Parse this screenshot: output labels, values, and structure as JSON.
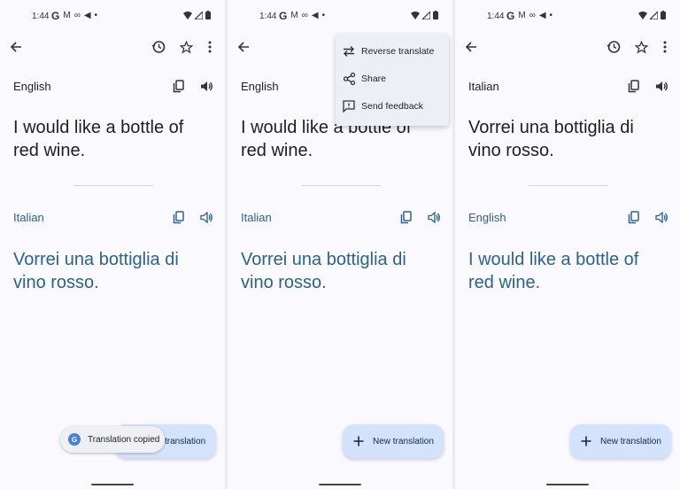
{
  "status_bar": {
    "time": "1:44",
    "left_icons": [
      "google-icon",
      "gmail-icon",
      "link-icon",
      "send-icon",
      "dot-icon"
    ],
    "right_icons": [
      "wifi-icon",
      "signal-icon",
      "battery-icon"
    ]
  },
  "screens": [
    {
      "source": {
        "lang": "English",
        "text": "I would like a bottle of red wine."
      },
      "target": {
        "lang": "Italian",
        "text": "Vorrei una bottiglia di vino rosso."
      },
      "fab_label": "New translation",
      "fab_label_visible": "translation",
      "toast": "Translation copied"
    },
    {
      "source": {
        "lang": "English",
        "text": "I would like a bottle of red wine."
      },
      "target": {
        "lang": "Italian",
        "text": "Vorrei una bottiglia di vino rosso."
      },
      "fab_label": "New translation",
      "menu": [
        {
          "label": "Reverse translate",
          "icon": "swap-icon"
        },
        {
          "label": "Share",
          "icon": "share-icon"
        },
        {
          "label": "Send feedback",
          "icon": "feedback-icon"
        }
      ]
    },
    {
      "source": {
        "lang": "Italian",
        "text": "Vorrei una bottiglia di vino rosso."
      },
      "target": {
        "lang": "English",
        "text": "I would like a bottle of red wine."
      },
      "fab_label": "New translation"
    }
  ],
  "colors": {
    "background": "#f9f9fe",
    "accent_text": "#2a6290",
    "fab": "#d3e3fd",
    "menu": "#ecf0f6"
  }
}
